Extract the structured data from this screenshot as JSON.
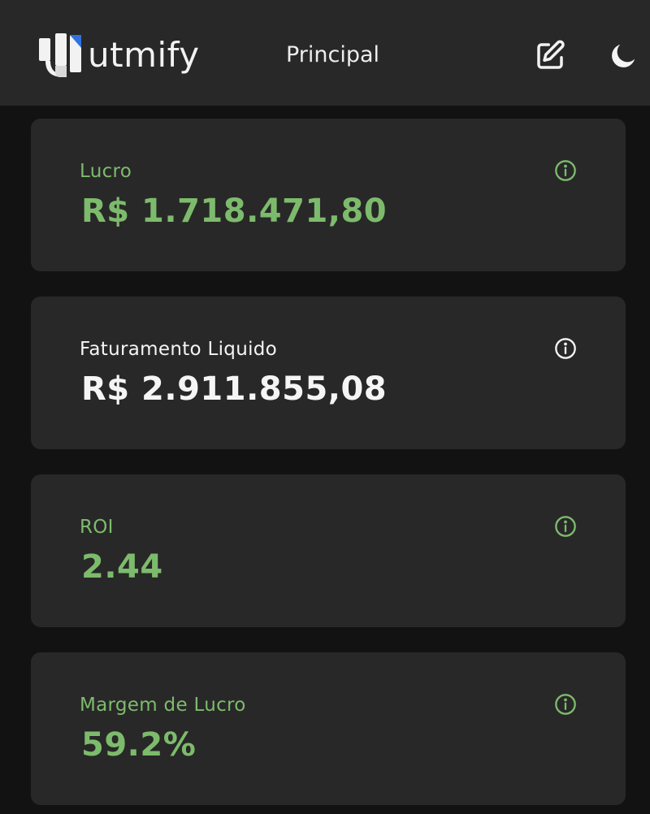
{
  "header": {
    "brand": "utmify",
    "title": "Principal",
    "icons": {
      "edit": "edit-icon",
      "theme": "moon-icon"
    }
  },
  "colors": {
    "accent_green": "#7dbb6c",
    "background": "#121212",
    "card": "#282828",
    "logo_blue": "#2f72e0"
  },
  "cards": [
    {
      "label": "Lucro",
      "value": "R$ 1.718.471,80",
      "tone": "green"
    },
    {
      "label": "Faturamento Liquido",
      "value": "R$ 2.911.855,08",
      "tone": "white"
    },
    {
      "label": "ROI",
      "value": "2.44",
      "tone": "green"
    },
    {
      "label": "Margem de Lucro",
      "value": "59.2%",
      "tone": "green"
    }
  ]
}
